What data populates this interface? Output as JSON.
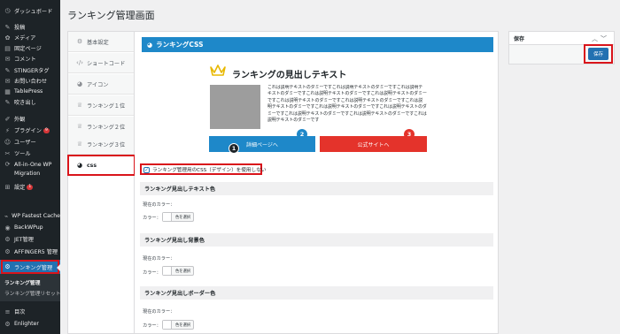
{
  "sidebar": {
    "items": [
      {
        "label": "ダッシュボード",
        "icon": "dashboard-icon"
      },
      {
        "label": "投稿",
        "icon": "pin-icon"
      },
      {
        "label": "メディア",
        "icon": "media-icon"
      },
      {
        "label": "固定ページ",
        "icon": "page-icon"
      },
      {
        "label": "コメント",
        "icon": "comment-icon"
      },
      {
        "label": "STINGERタグ",
        "icon": "pin-icon"
      },
      {
        "label": "お問い合わせ",
        "icon": "mail-icon"
      },
      {
        "label": "TablePress",
        "icon": "table-icon"
      },
      {
        "label": "吹き出し",
        "icon": "pin-icon"
      },
      {
        "label": "外観",
        "icon": "brush-icon"
      },
      {
        "label": "プラグイン",
        "icon": "plugin-icon",
        "badge": "9"
      },
      {
        "label": "ユーザー",
        "icon": "user-icon"
      },
      {
        "label": "ツール",
        "icon": "wrench-icon"
      },
      {
        "label": "All-in-One WP",
        "icon": "migration-icon"
      },
      {
        "label": "Migration",
        "icon": ""
      },
      {
        "label": "設定",
        "icon": "settings-icon",
        "badge": "1"
      },
      {
        "label": "WP Fastest Cache",
        "icon": "cache-icon"
      },
      {
        "label": "BackWPup",
        "icon": "backup-icon"
      },
      {
        "label": "JET管理",
        "icon": "gear-icon"
      },
      {
        "label": "AFFINGER5 管理",
        "icon": "gear-icon"
      },
      {
        "label": "ランキング管理",
        "icon": "gear-icon"
      },
      {
        "label": "目次",
        "icon": "list-icon"
      },
      {
        "label": "Enlighter",
        "icon": "code-icon"
      }
    ],
    "submenu": [
      "ランキング管理",
      "ランキング管理リセット"
    ]
  },
  "page": {
    "title": "ランキング管理画面"
  },
  "tabs": [
    {
      "label": "基本設定",
      "icon": "gear-icon"
    },
    {
      "label": "ショートコード",
      "icon": "code-icon"
    },
    {
      "label": "アイコン",
      "icon": "palette-icon"
    },
    {
      "label": "ランキング１位",
      "icon": "trophy-icon"
    },
    {
      "label": "ランキング２位",
      "icon": "trophy-icon"
    },
    {
      "label": "ランキング３位",
      "icon": "trophy-icon"
    },
    {
      "label": "css",
      "icon": "palette-icon",
      "active": true
    }
  ],
  "panel": {
    "header": "ランキングCSS",
    "preview_title": "ランキングの見出しテキスト",
    "preview_text": "これは説明テキストのダミーですこれは説明テキストのダミーですこれは説明テキストのダミーですこれは説明テキストのダミーですこれは説明テキストのダミーですこれは説明テキストのダミーですこれは説明テキストのダミーですこれは説明テキストのダミーですこれは説明テキストのダミーですこれは説明テキストのダミーですこれは説明テキストのダミーですこれは説明テキストのダミーですこれは説明テキストのダミーです",
    "btn_detail": "詳細ページへ",
    "btn_official": "公式サイトへ",
    "num1": "1",
    "num2": "2",
    "num3": "3",
    "css_checkbox_label": "ランキング管理用のCSS（デザイン）を使用しない",
    "css_checkbox_checked": true,
    "sections": [
      {
        "title": "ランキング見出しテキスト色",
        "current_label": "現在のカラー：",
        "color_label": "カラー：",
        "button_text": "色を選択"
      },
      {
        "title": "ランキング見出し背景色",
        "current_label": "現在のカラー：",
        "color_label": "カラー：",
        "button_text": "色を選択"
      },
      {
        "title": "ランキング見出しボーダー色",
        "current_label": "現在のカラー：",
        "color_label": "カラー：",
        "button_text": "色を選択"
      }
    ]
  },
  "save_box": {
    "title": "保存",
    "button": "保存"
  },
  "colors": {
    "accent": "#1e88c9",
    "red": "#e4332b",
    "highlight": "#d9141b",
    "sidebar": "#1d2327",
    "wp_blue": "#2271b1"
  }
}
